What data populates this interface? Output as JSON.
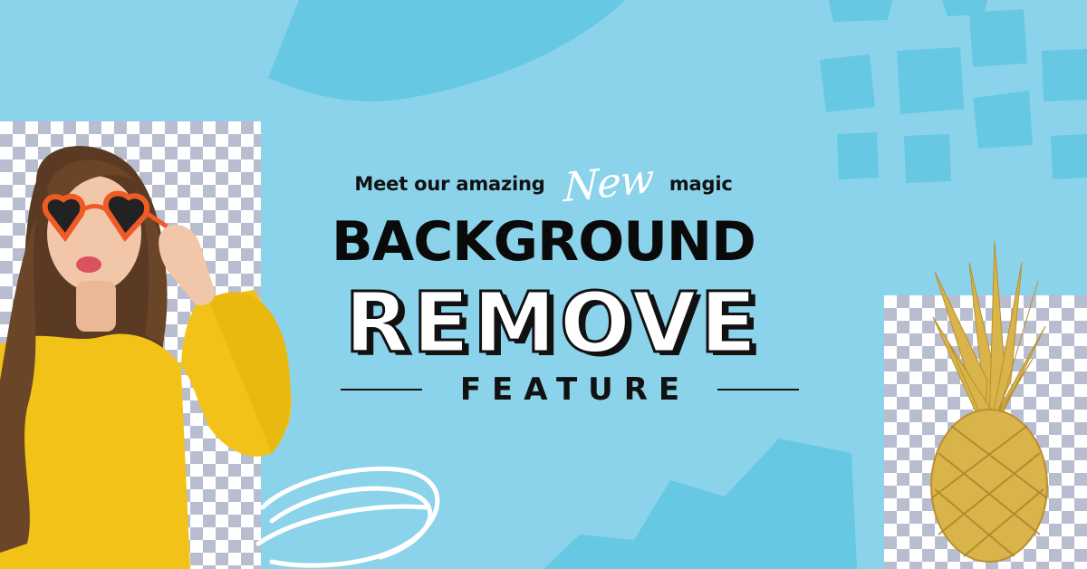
{
  "banner": {
    "intro_before": "Meet our amazing",
    "intro_highlight": "New",
    "intro_after": "magic",
    "title_line1": "BACKGROUND",
    "title_line2": "REMOVE",
    "title_line3": "FEATURE"
  },
  "colors": {
    "background": "#8bd3eb",
    "accent_blob": "#66c8e2",
    "text_dark": "#111111",
    "sweater_yellow": "#f2c218",
    "sunglasses_orange": "#f05a24",
    "pineapple_gold": "#d9b44a"
  },
  "images": {
    "left": "woman-in-yellow-sweater-with-heart-sunglasses",
    "right": "gold-pineapple"
  }
}
